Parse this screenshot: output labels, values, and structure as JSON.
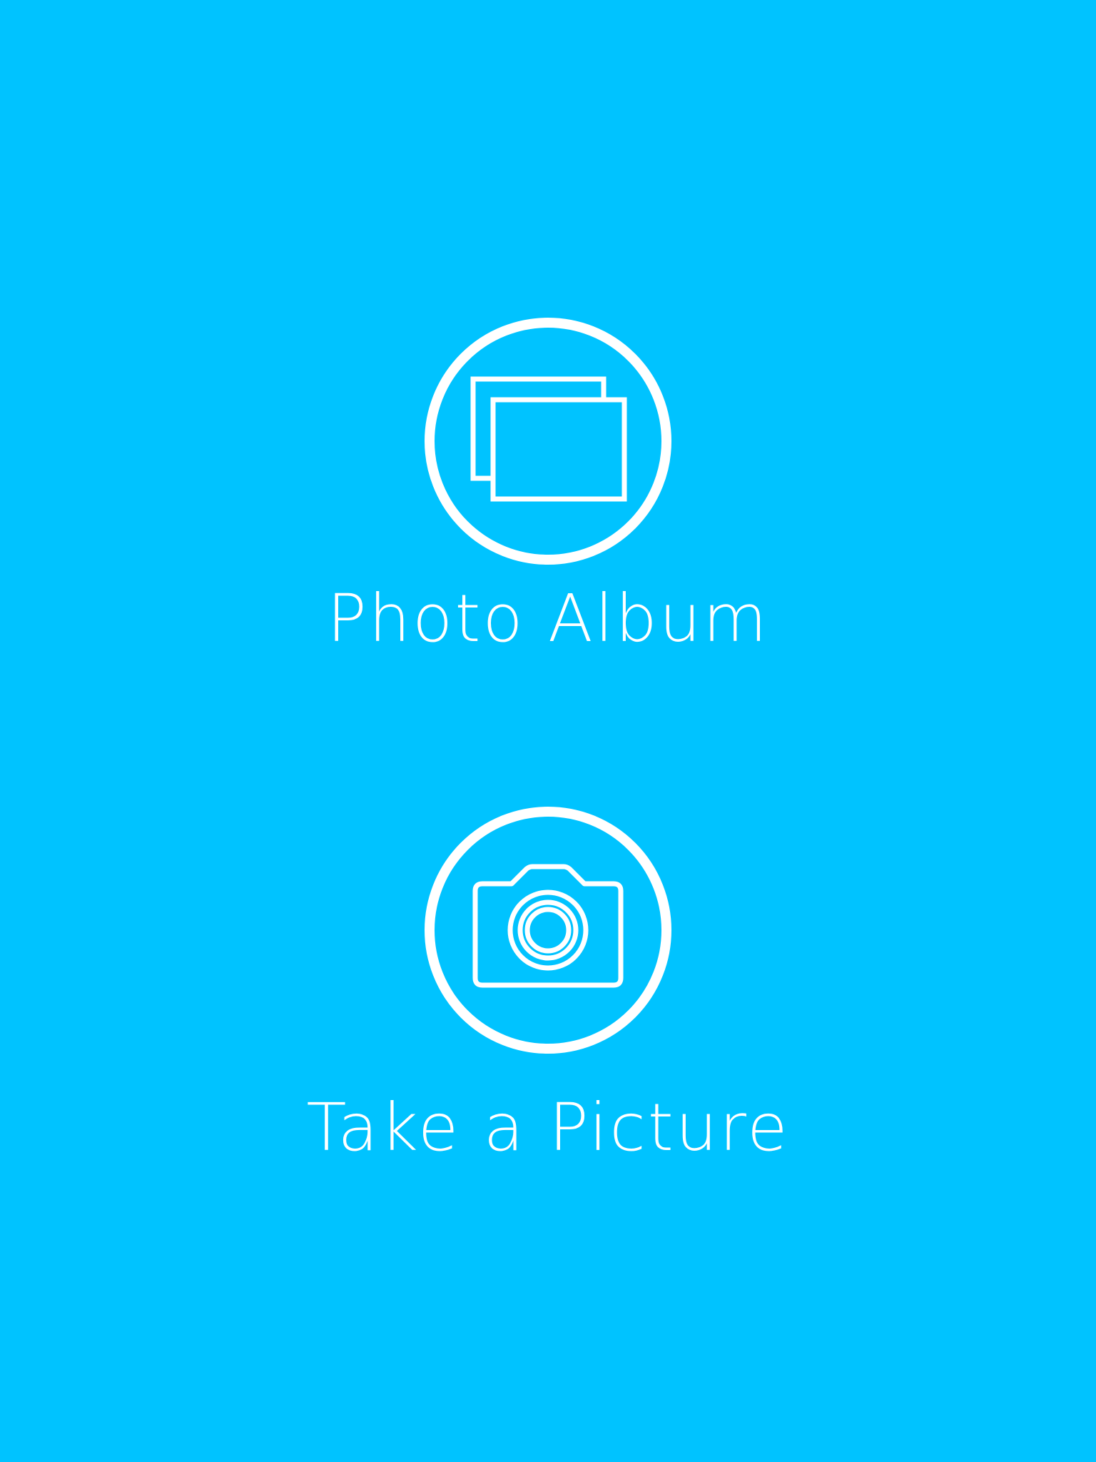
{
  "theme": {
    "background": "#00C3FF",
    "foreground": "#FFFFFF"
  },
  "options": [
    {
      "label": "Photo Album",
      "icon": "photo-album-icon"
    },
    {
      "label": "Take a Picture",
      "icon": "camera-icon"
    }
  ]
}
